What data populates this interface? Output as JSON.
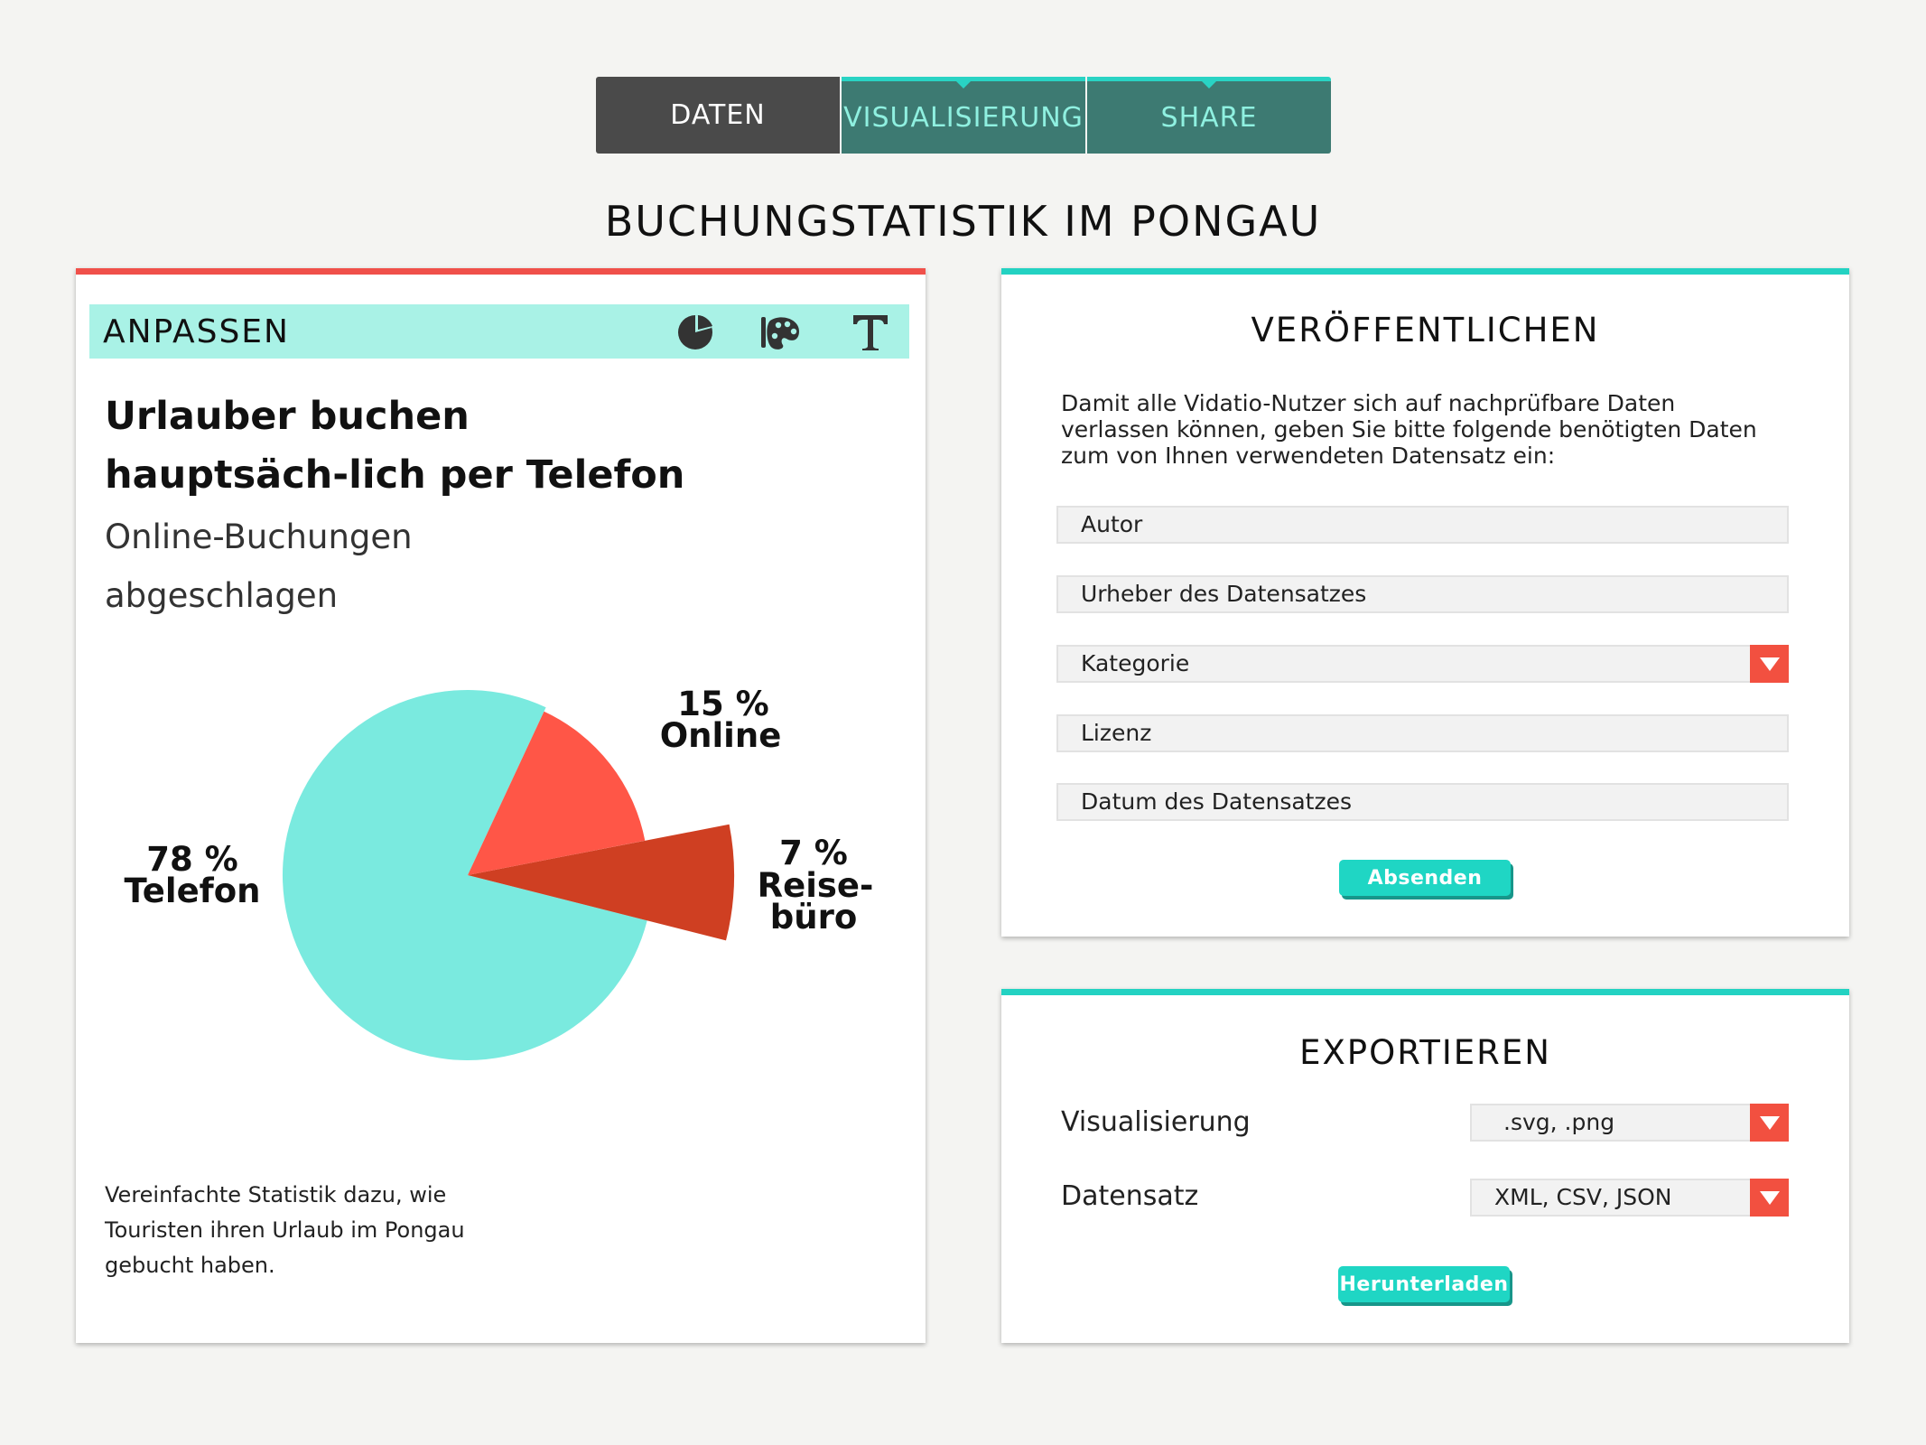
{
  "tabs": [
    {
      "label": "DATEN"
    },
    {
      "label": "VISUALISIERUNG"
    },
    {
      "label": "SHARE"
    }
  ],
  "page_title": "BUCHUNGSTATISTIK IM PONGAU",
  "customize_panel": {
    "title": "ANPASSEN",
    "tools": [
      "pie-chart-icon",
      "palette-icon",
      "text-icon"
    ],
    "chart_title": "Urlauber buchen hauptsäch-lich per Telefon",
    "chart_subtitle": "Online-Buchungen abgeschlagen",
    "chart_note": "Vereinfachte Statistik dazu, wie Touristen ihren Urlaub im Pongau gebucht haben."
  },
  "chart_data": {
    "type": "pie",
    "slices": [
      {
        "value": 78,
        "label_value": "78 %",
        "label": "Telefon",
        "color": "#7aeadf"
      },
      {
        "value": 15,
        "label_value": "15 %",
        "label": "Online",
        "color": "#ff5647"
      },
      {
        "value": 7,
        "label_value": "7 %",
        "label_line1": "Reise-",
        "label_line2": "büro",
        "color": "#cf3f22"
      }
    ]
  },
  "publish_panel": {
    "title": "VERÖFFENTLICHEN",
    "description": "Damit alle Vidatio-Nutzer sich auf nachprüfbare Daten verlassen können, geben Sie bitte folgende benötigten Daten zum von Ihnen verwendeten Datensatz ein:",
    "fields": {
      "author": "Autor",
      "origin": "Urheber des Datensatzes",
      "category": "Kategorie",
      "license": "Lizenz",
      "date": "Datum des Datensatzes"
    },
    "submit_label": "Absenden"
  },
  "export_panel": {
    "title": "EXPORTIEREN",
    "visualization_label": "Visualisierung",
    "visualization_format": ".svg, .png",
    "dataset_label": "Datensatz",
    "dataset_format": "XML, CSV, JSON",
    "download_label": "Herunterladen"
  },
  "colors": {
    "accent_teal": "#23d2c2",
    "accent_red": "#f0504a",
    "tab_dark": "#4a4a4a",
    "tab_teal": "#3d7a72"
  }
}
